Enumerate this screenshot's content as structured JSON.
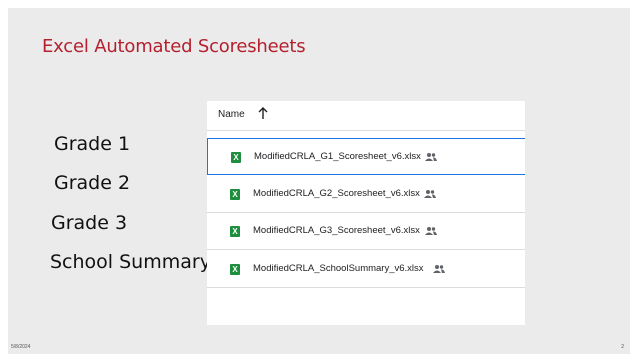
{
  "slide": {
    "title": "Excel Automated Scoresheets",
    "grades": [
      "Grade 1",
      "Grade 2",
      "Grade 3",
      "School Summary"
    ],
    "footer_date": "5/8/2024",
    "page_number": "2"
  },
  "file_list": {
    "column_name": "Name",
    "sort_icon": "arrow-up-icon",
    "file_icon": "excel-icon",
    "file_icon_letter": "X",
    "shared_icon": "shared-people-icon",
    "files": [
      {
        "name": "ModifiedCRLA_G1_Scoresheet_v6.xlsx",
        "selected": true
      },
      {
        "name": "ModifiedCRLA_G2_Scoresheet_v6.xlsx",
        "selected": false
      },
      {
        "name": "ModifiedCRLA_G3_Scoresheet_v6.xlsx",
        "selected": false
      },
      {
        "name": "ModifiedCRLA_SchoolSummary_v6.xlsx",
        "selected": false
      }
    ]
  },
  "colors": {
    "title": "#b5202e",
    "excel_green": "#1e8e3e",
    "selection_border": "#1a73e8"
  }
}
